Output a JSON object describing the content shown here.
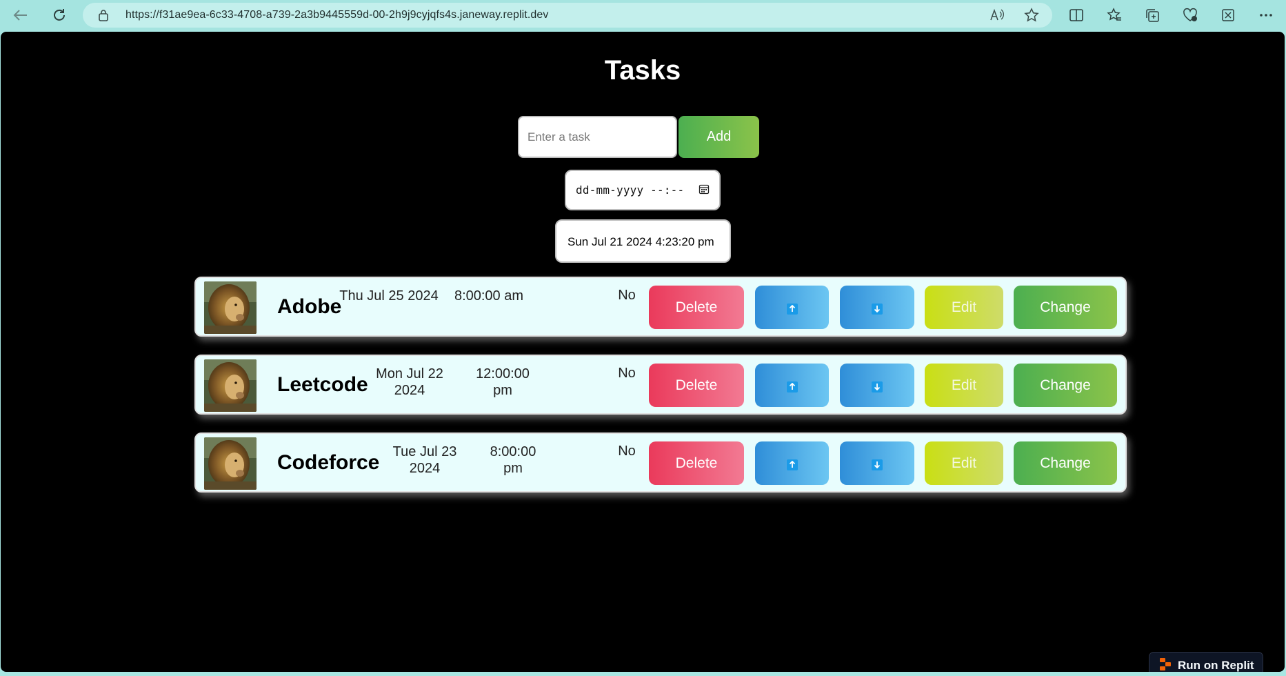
{
  "browser": {
    "url": "https://f31ae9ea-6c33-4708-a739-2a3b9445559d-00-2h9j9cyjqfs4s.janeway.replit.dev",
    "icons": [
      "back-icon",
      "refresh-icon",
      "lock-icon",
      "read-aloud-icon",
      "favorite-star-icon",
      "split-screen-icon",
      "favorites-icon",
      "collections-icon",
      "browser-essentials-icon",
      "extensions-icon",
      "more-icon"
    ]
  },
  "page": {
    "title": "Tasks",
    "task_input_placeholder": "Enter a task",
    "add_label": "Add",
    "datetime_placeholder": "dd-mm-yyyy --:--",
    "current_time": "Sun Jul 21 2024 4:23:20 pm"
  },
  "tasks": [
    {
      "name": "Adobe",
      "date": "Thu Jul 25 2024",
      "time": "8:00:00 am",
      "done": "No",
      "image": "lion-photo"
    },
    {
      "name": "Leetcode",
      "date": "Mon Jul 22 2024",
      "time": "12:00:00 pm",
      "done": "No",
      "image": "lion-photo"
    },
    {
      "name": "Codeforce",
      "date": "Tue Jul 23 2024",
      "time": "8:00:00 pm",
      "done": "No",
      "image": "lion-photo"
    }
  ],
  "row_buttons": {
    "delete": "Delete",
    "move_up_icon": "arrow-up-icon",
    "move_down_icon": "arrow-down-icon",
    "edit": "Edit",
    "change": "Change"
  },
  "replit_badge": "Run on Replit",
  "colors": {
    "page_bg": "#000000",
    "row_bg": "#e8fdfd",
    "delete": "#ea3a5b",
    "move": "#2f8ed8",
    "edit": "#c9df14",
    "change": "#4caf50",
    "chrome": "#a5e4e0"
  }
}
